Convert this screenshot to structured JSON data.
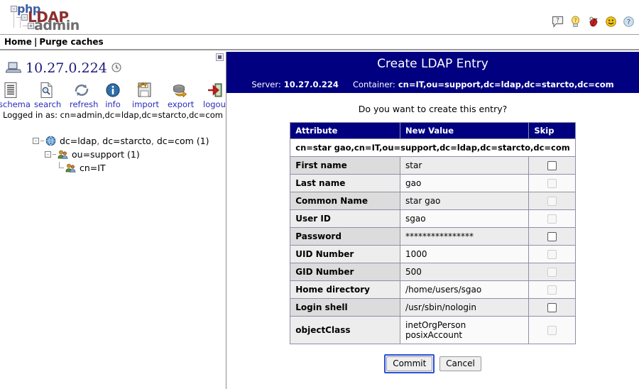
{
  "logo": {
    "part1": "php",
    "part2": "LDAP",
    "part3": "admin",
    "node1": "-",
    "node2": "-",
    "node3": "+"
  },
  "top_icons": [
    {
      "name": "help-balloon-icon",
      "title": "?"
    },
    {
      "name": "hint-lightbulb-icon",
      "title": "?"
    },
    {
      "name": "bug-report-icon",
      "title": "bug"
    },
    {
      "name": "smiley-face-icon",
      "title": "smiley"
    },
    {
      "name": "about-question-icon",
      "title": "?"
    }
  ],
  "breadcrumb": {
    "home": "Home",
    "separator": "|",
    "purge": "Purge caches"
  },
  "sidebar": {
    "server": "10.27.0.224",
    "toolbar": [
      {
        "label": "schema",
        "icon": "schema-document-icon"
      },
      {
        "label": "search",
        "icon": "search-document-icon"
      },
      {
        "label": "refresh",
        "icon": "refresh-arrows-icon"
      },
      {
        "label": "info",
        "icon": "info-circle-icon"
      },
      {
        "label": "import",
        "icon": "import-floppy-icon"
      },
      {
        "label": "export",
        "icon": "export-disk-icon"
      },
      {
        "label": "logout",
        "icon": "logout-door-icon"
      }
    ],
    "logged_in_label": "Logged in as:",
    "logged_in_dn": "cn=admin,dc=ldap,dc=starcto,dc=com",
    "tree": [
      {
        "label": "dc=ldap, dc=starcto, dc=com (1)",
        "icon": "globe-icon",
        "expander": "-",
        "level": 1
      },
      {
        "label": "ou=support (1)",
        "icon": "users-group-icon",
        "expander": "-",
        "level": 2
      },
      {
        "label": "cn=IT",
        "icon": "users-group-icon",
        "expander": "",
        "level": 3
      }
    ]
  },
  "main": {
    "title": "Create LDAP Entry",
    "server_label": "Server:",
    "server_value": "10.27.0.224",
    "container_label": "Container:",
    "container_value": "cn=IT,ou=support,dc=ldap,dc=starcto,dc=com",
    "question": "Do you want to create this entry?",
    "table": {
      "headers": [
        "Attribute",
        "New Value",
        "Skip"
      ],
      "dn": "cn=star gao,cn=IT,ou=support,dc=ldap,dc=starcto,dc=com",
      "rows": [
        {
          "attribute": "First name",
          "value": "star",
          "skip_enabled": true,
          "skip_checked": false
        },
        {
          "attribute": "Last name",
          "value": "gao",
          "skip_enabled": false,
          "skip_checked": false
        },
        {
          "attribute": "Common Name",
          "value": "star gao",
          "skip_enabled": false,
          "skip_checked": false
        },
        {
          "attribute": "User ID",
          "value": "sgao",
          "skip_enabled": false,
          "skip_checked": false
        },
        {
          "attribute": "Password",
          "value": "****************",
          "skip_enabled": true,
          "skip_checked": false
        },
        {
          "attribute": "UID Number",
          "value": "1000",
          "skip_enabled": false,
          "skip_checked": false
        },
        {
          "attribute": "GID Number",
          "value": "500",
          "skip_enabled": false,
          "skip_checked": false
        },
        {
          "attribute": "Home directory",
          "value": "/home/users/sgao",
          "skip_enabled": false,
          "skip_checked": false
        },
        {
          "attribute": "Login shell",
          "value": "/usr/sbin/nologin",
          "skip_enabled": true,
          "skip_checked": false
        },
        {
          "attribute": "objectClass",
          "value": "inetOrgPerson\nposixAccount",
          "skip_enabled": false,
          "skip_checked": false
        }
      ]
    },
    "commit_label": "Commit",
    "cancel_label": "Cancel"
  },
  "colors": {
    "header_blue": "#000080",
    "link_blue": "#2b2bbb",
    "focus_blue": "#2a4fd6",
    "logo_red": "#8c2f2f"
  }
}
